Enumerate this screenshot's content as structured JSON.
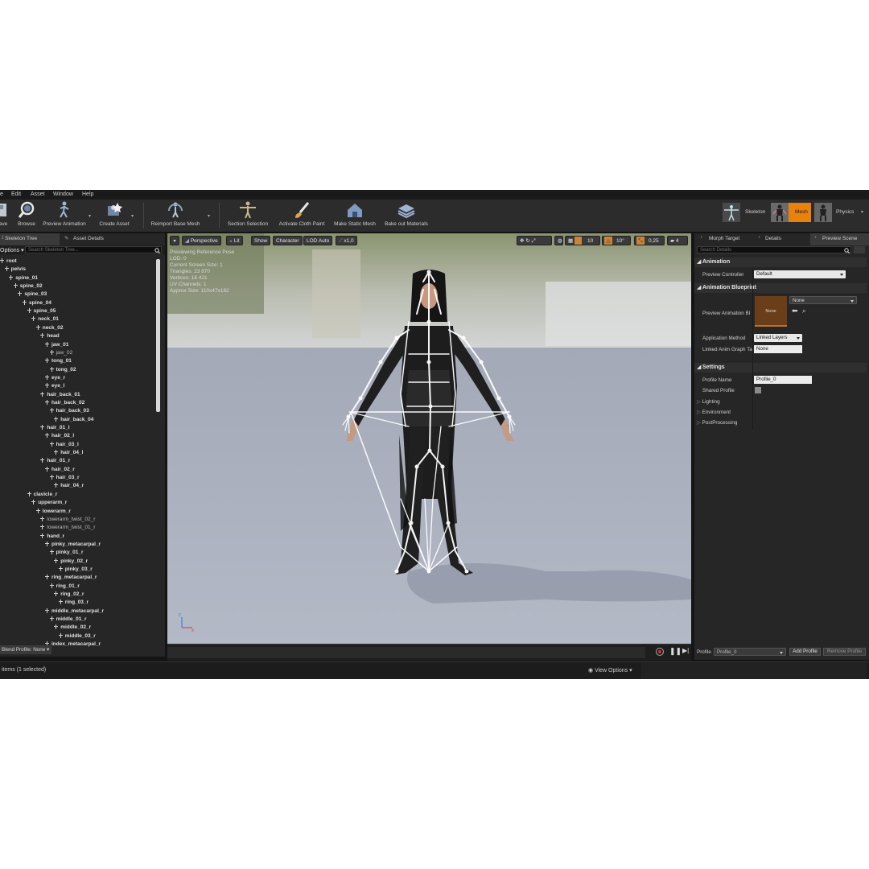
{
  "menu": [
    "e",
    "Edit",
    "Asset",
    "Window",
    "Help"
  ],
  "toolbar": {
    "buttons": [
      "ave",
      "Browse",
      "Preview Animation",
      "Create Asset",
      "Reimport Base Mesh",
      "Section Selection",
      "Activate Cloth Paint",
      "Make Static Mesh",
      "Bake out Materials"
    ]
  },
  "modes": {
    "skeleton": "Skeleton",
    "mesh": "Mesh",
    "physics": "Physics",
    "accent": "#e8820c"
  },
  "left_panel": {
    "tabs": [
      "Skeleton Tree",
      "Asset Details"
    ],
    "options_label": "Options",
    "search_placeholder": "Search Skeleton Tree...",
    "bones": [
      "root",
      "pelvis",
      "spine_01",
      "spine_02",
      "spine_03",
      "spine_04",
      "spine_05",
      "neck_01",
      "neck_02",
      "head",
      "jaw_01",
      "jaw_02",
      "tong_01",
      "tong_02",
      "eye_r",
      "eye_l",
      "hair_back_01",
      "hair_back_02",
      "hair_back_03",
      "hair_back_04",
      "hair_01_l",
      "hair_02_l",
      "hair_03_l",
      "hair_04_l",
      "hair_01_r",
      "hair_02_r",
      "hair_03_r",
      "hair_04_r",
      "clavicle_r",
      "upperarm_r",
      "lowerarm_r",
      "lowerarm_twist_02_r",
      "lowerarm_twist_01_r",
      "hand_r",
      "pinky_metacarpal_r",
      "pinky_01_r",
      "pinky_02_r",
      "pinky_03_r",
      "ring_metacarpal_r",
      "ring_01_r",
      "ring_02_r",
      "ring_03_r",
      "middle_metacarpal_r",
      "middle_01_r",
      "middle_02_r",
      "middle_03_r",
      "index_metacarpal_r"
    ],
    "blend_profile": "Blend Profile: None"
  },
  "viewport": {
    "buttons": [
      "Perspective",
      "Lit",
      "Show",
      "Character",
      "LOD Auto",
      "x1,0"
    ],
    "right_values": [
      "10",
      "10°",
      "0,25",
      "4"
    ],
    "stats": [
      "Previewing Reference Pose",
      "LOD: 0",
      "Current Screen Size: 1",
      "Triangles: 23 870",
      "Vertices: 16 421",
      "UV Channels: 1",
      "Approx Size: 110x47x182"
    ]
  },
  "right_panel": {
    "tabs": [
      "Morph Target",
      "Details",
      "Preview Scene"
    ],
    "search_placeholder": "Search Details",
    "animation_section": "Animation",
    "preview_controller_label": "Preview Controller",
    "preview_controller_value": "Default",
    "blueprint_section": "Animation Blueprint",
    "preview_bp_label": "Preview Animation Bl",
    "thumb_label": "None",
    "preview_bp_value": "None",
    "application_method_label": "Application Method",
    "application_method_value": "Linked Layers",
    "linked_graph_label": "Linked Anim Graph Ta",
    "linked_graph_value": "None",
    "settings_section": "Settings",
    "profile_name_label": "Profile Name",
    "profile_name_value": "Profile_0",
    "shared_profile_label": "Shared Profile",
    "subsections": [
      "Lighting",
      "Environment",
      "PostProcessing"
    ],
    "profile_label": "Profile",
    "profile_value": "Profile_0",
    "add_profile": "Add Profile",
    "remove_profile": "Remove Profile"
  },
  "status": {
    "items": "items (1 selected)",
    "view_options": "View Options"
  }
}
